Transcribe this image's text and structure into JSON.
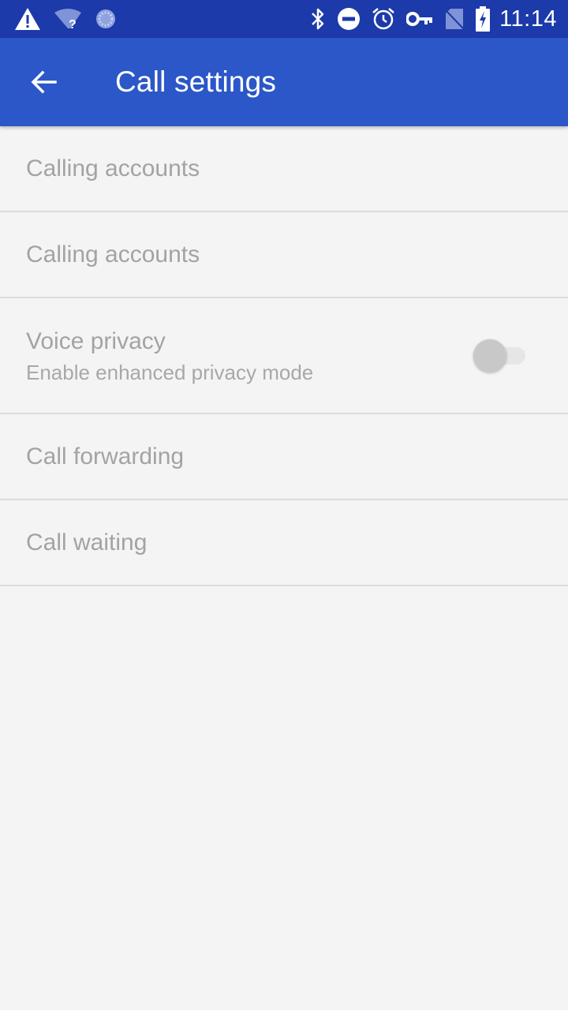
{
  "status_bar": {
    "time": "11:14",
    "left_icons": [
      "warning-icon",
      "wifi-unknown-icon",
      "sync-icon"
    ],
    "right_icons": [
      "bluetooth-icon",
      "do-not-disturb-icon",
      "alarm-icon",
      "vpn-key-icon",
      "no-sim-icon",
      "battery-charging-icon"
    ]
  },
  "app_bar": {
    "title": "Call settings",
    "background": "#2b57c8",
    "status_background": "#1c3aa9"
  },
  "settings": [
    {
      "title": "Calling accounts"
    },
    {
      "title": "Calling accounts"
    },
    {
      "title": "Voice privacy",
      "summary": "Enable enhanced privacy mode",
      "toggle": false
    },
    {
      "title": "Call forwarding"
    },
    {
      "title": "Call waiting"
    }
  ]
}
